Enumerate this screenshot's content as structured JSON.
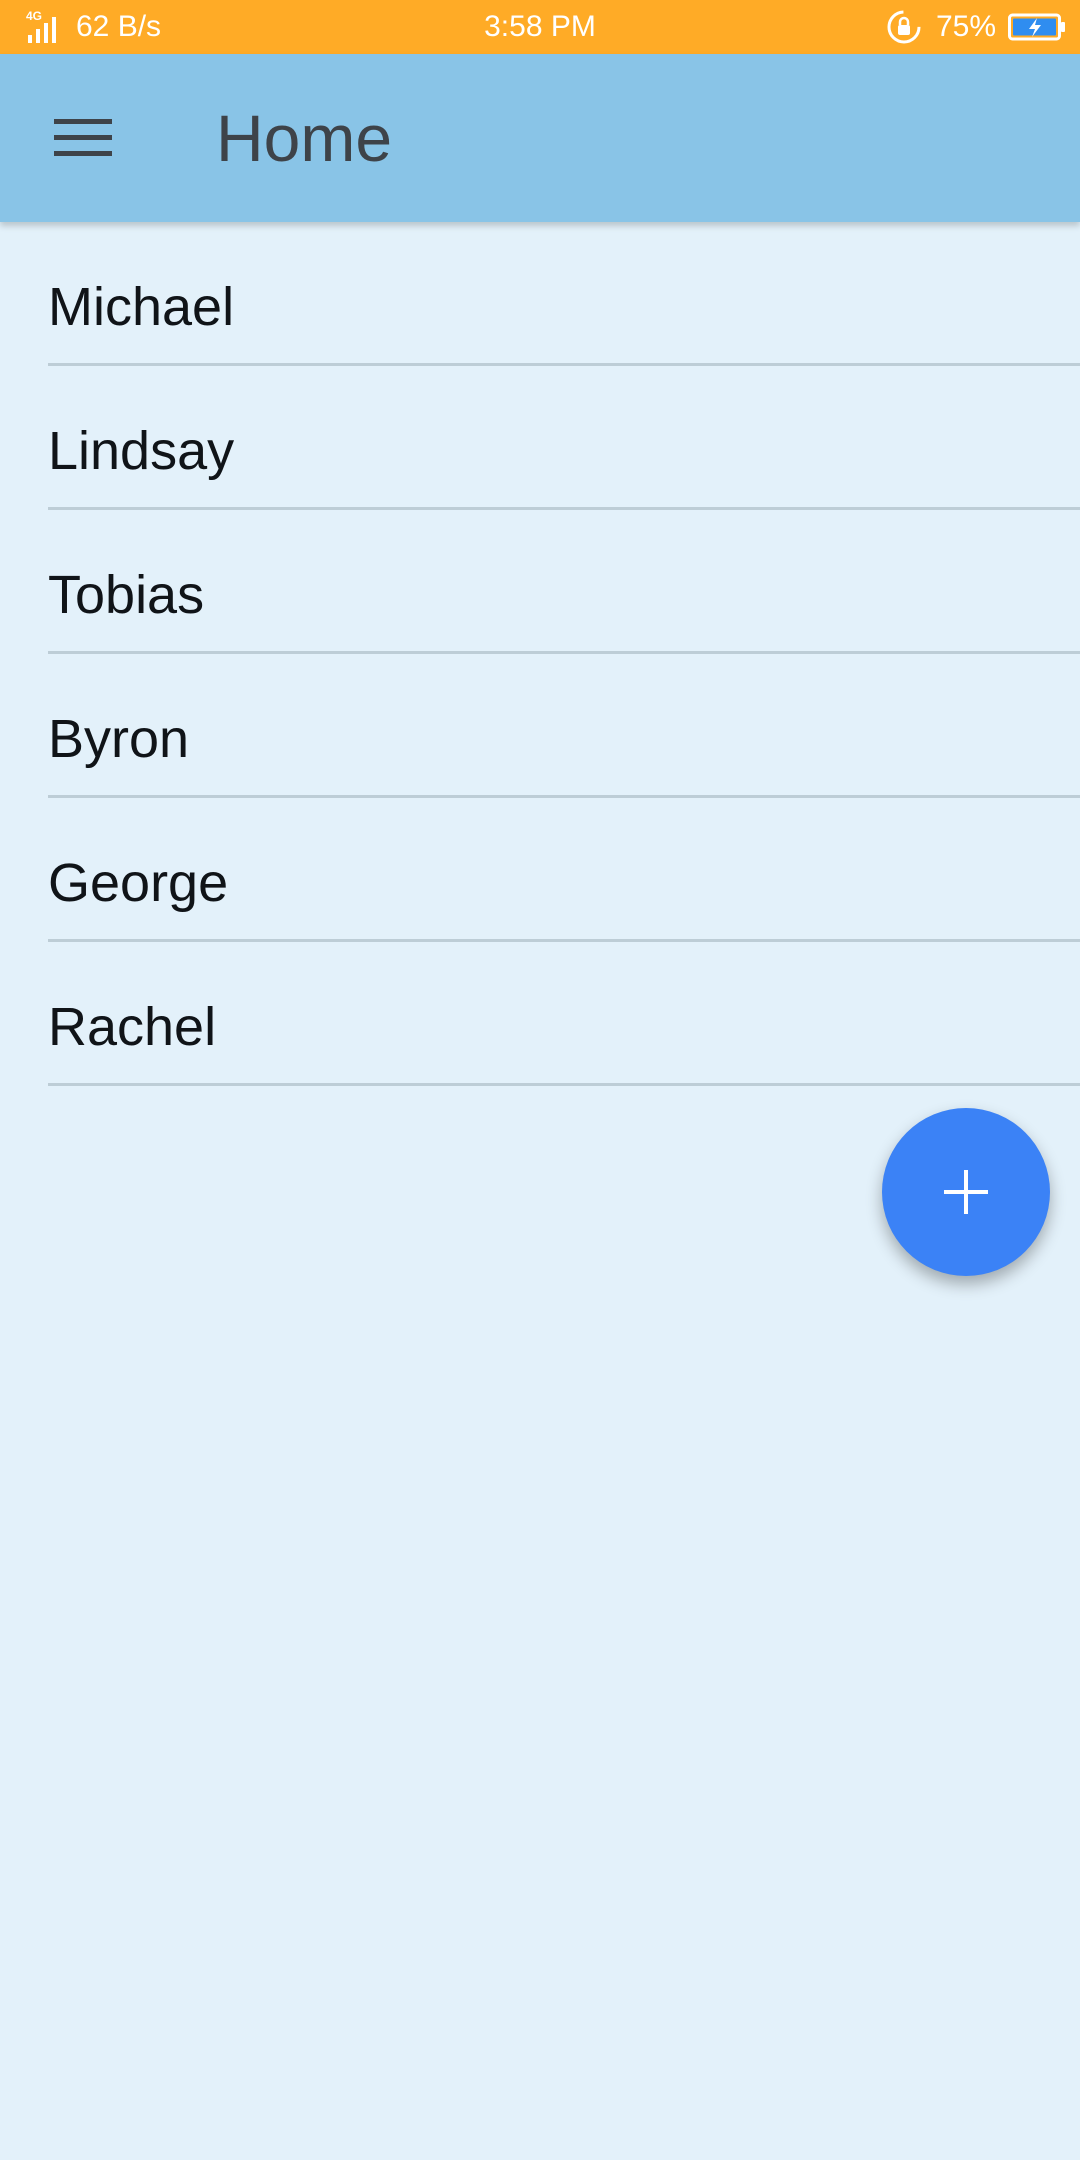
{
  "status_bar": {
    "network_tag": "4G",
    "net_speed": "62 B/s",
    "time": "3:58 PM",
    "battery": "75%",
    "color": "#ffab26"
  },
  "app_bar": {
    "title": "Home",
    "menu_icon": "hamburger-menu-icon",
    "color": "#89c4e7"
  },
  "list": {
    "items": [
      "Michael",
      "Lindsay",
      "Tobias",
      "Byron",
      "George",
      "Rachel"
    ]
  },
  "fab": {
    "icon": "plus-icon",
    "color": "#3b82f6"
  },
  "colors": {
    "background": "#e3f1fa",
    "divider": "#bdcdd6"
  }
}
